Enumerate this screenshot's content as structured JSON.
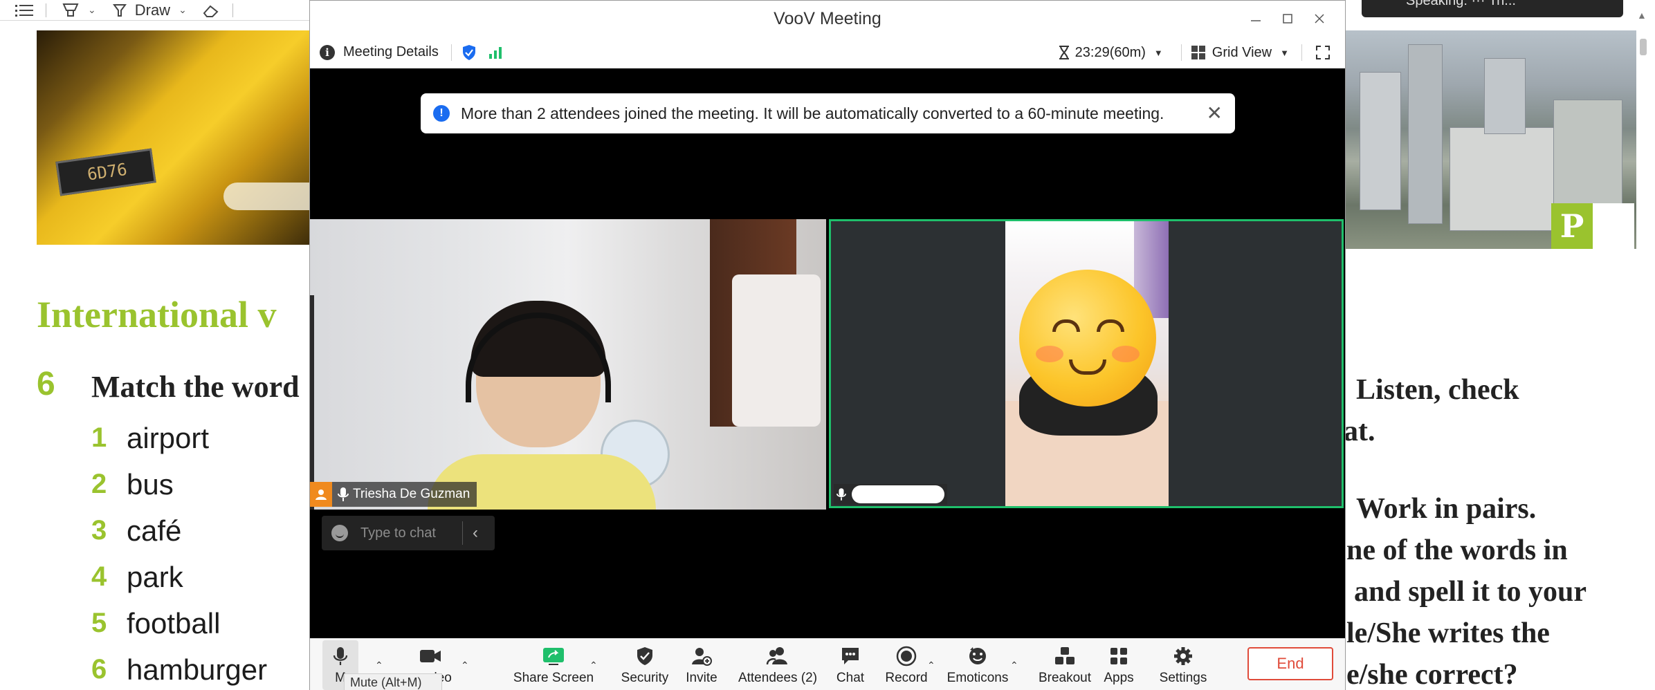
{
  "document": {
    "toolbar": {
      "draw_label": "Draw"
    },
    "heading": "International v",
    "exercise_number": "6",
    "instruction": "Match the word",
    "words": [
      {
        "num": "1",
        "word": "airport"
      },
      {
        "num": "2",
        "word": "bus"
      },
      {
        "num": "3",
        "word": "café"
      },
      {
        "num": "4",
        "word": "park"
      },
      {
        "num": "5",
        "word": "football"
      },
      {
        "num": "6",
        "word": "hamburger"
      }
    ],
    "badge_letter": "P",
    "right_lines": [
      "Listen, check",
      "at.",
      "Work in pairs.",
      "ne of the words in",
      "and spell it to your",
      "le/She writes the",
      "e/she correct?"
    ],
    "speaking_indicator": "Speaking: ··· Tri..."
  },
  "meeting": {
    "window_title": "VooV Meeting",
    "info_bar": {
      "details_label": "Meeting Details",
      "timer": "23:29(60m)",
      "view_label": "Grid View"
    },
    "notice": "More than 2 attendees joined the meeting. It will be automatically converted to a 60-minute meeting.",
    "participants": [
      {
        "name": "Triesha De Guzman"
      },
      {
        "name": ""
      }
    ],
    "chat_placeholder": "Type to chat",
    "toolbar": {
      "mute_label": "M",
      "video_label": "deo",
      "share_label": "Share Screen",
      "security_label": "Security",
      "invite_label": "Invite",
      "attendees_label": "Attendees (2)",
      "chat_label": "Chat",
      "record_label": "Record",
      "emoticons_label": "Emoticons",
      "breakout_label": "Breakout",
      "apps_label": "Apps",
      "settings_label": "Settings",
      "end_label": "End"
    },
    "tooltip": "Mute (Alt+M)"
  },
  "colors": {
    "accent_green": "#9ac32e",
    "active_speaker_border": "#1fbf6b",
    "end_red": "#e04b3a",
    "notice_blue": "#1a6cf0",
    "participant_badge_orange": "#f08a1e"
  }
}
